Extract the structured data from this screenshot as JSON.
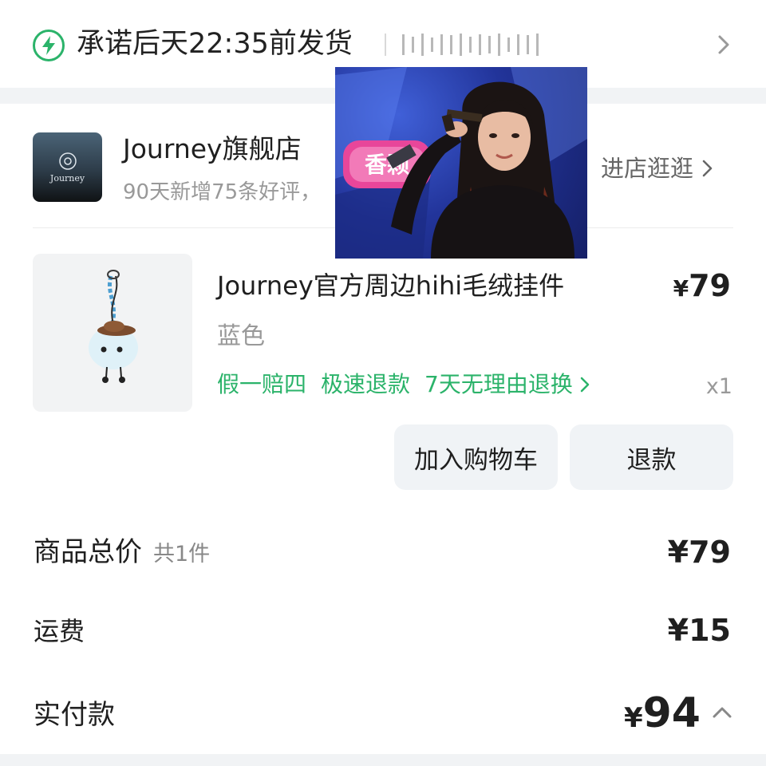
{
  "delivery": {
    "text": "承诺后天22:35前发货",
    "icon": "lightning-icon",
    "accent": "#2bb36a"
  },
  "store": {
    "name": "Journey旗舰店",
    "subtitle": "90天新增75条好评，",
    "logo_text": "Journey",
    "visit_label": "进店逛逛"
  },
  "product": {
    "title": "Journey官方周边hihi毛绒挂件",
    "price_symbol": "¥",
    "price": "79",
    "variant": "蓝色",
    "guarantees": [
      "假一赔四",
      "极速退款",
      "7天无理由退换"
    ],
    "quantity": "x1"
  },
  "actions": {
    "add_to_cart": "加入购物车",
    "refund": "退款"
  },
  "summary": {
    "subtotal_label": "商品总价",
    "subtotal_count": "共1件",
    "subtotal_value": "¥79",
    "shipping_label": "运费",
    "shipping_value": "¥15",
    "paid_label": "实付款",
    "paid_symbol": "¥",
    "paid_value": "94"
  },
  "overlay_photo": {
    "background_sign_text": "香颗"
  }
}
